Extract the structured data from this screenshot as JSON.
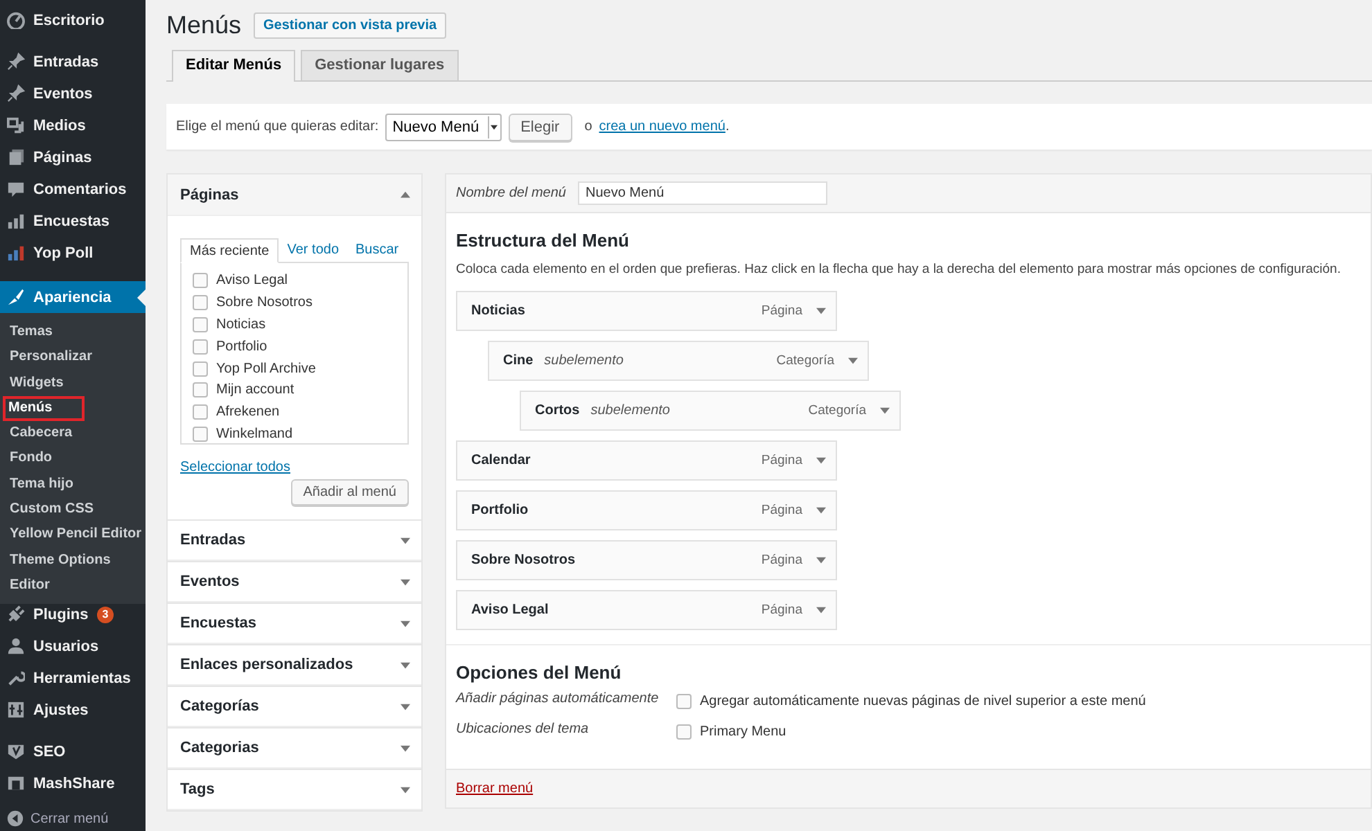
{
  "sidebar": {
    "sections": [
      [
        {
          "label": "Escritorio",
          "current": false
        }
      ],
      [
        {
          "label": "Entradas",
          "current": false
        },
        {
          "label": "Eventos",
          "current": false
        },
        {
          "label": "Medios",
          "current": false
        },
        {
          "label": "Páginas",
          "current": false
        },
        {
          "label": "Comentarios",
          "current": false
        },
        {
          "label": "Encuestas",
          "current": false
        },
        {
          "label": "Yop Poll",
          "current": false
        }
      ],
      [
        {
          "label": "Apariencia",
          "current": true,
          "submenu": [
            {
              "label": "Temas",
              "selected": false,
              "highlighted": false
            },
            {
              "label": "Personalizar",
              "selected": false,
              "highlighted": false
            },
            {
              "label": "Widgets",
              "selected": false,
              "highlighted": false
            },
            {
              "label": "Menús",
              "selected": true,
              "highlighted": true
            },
            {
              "label": "Cabecera",
              "selected": false,
              "highlighted": false
            },
            {
              "label": "Fondo",
              "selected": false,
              "highlighted": false
            },
            {
              "label": "Tema hijo",
              "selected": false,
              "highlighted": false
            },
            {
              "label": "Custom CSS",
              "selected": false,
              "highlighted": false
            },
            {
              "label": "Yellow Pencil Editor",
              "selected": false,
              "highlighted": false
            },
            {
              "label": "Theme Options",
              "selected": false,
              "highlighted": false
            },
            {
              "label": "Editor",
              "selected": false,
              "highlighted": false
            }
          ]
        },
        {
          "label": "Plugins",
          "current": false,
          "badge": "3"
        },
        {
          "label": "Usuarios",
          "current": false
        },
        {
          "label": "Herramientas",
          "current": false
        },
        {
          "label": "Ajustes",
          "current": false
        }
      ],
      [
        {
          "label": "SEO",
          "current": false
        },
        {
          "label": "MashShare",
          "current": false
        }
      ]
    ],
    "collapse_label": "Cerrar menú"
  },
  "page": {
    "title": "Menús",
    "preview_button": "Gestionar con vista previa"
  },
  "tabs": [
    {
      "label": "Editar Menús",
      "selected": true
    },
    {
      "label": "Gestionar lugares",
      "selected": false
    }
  ],
  "menu_select": {
    "label": "Elige el menú que quieras editar:",
    "value": "Nuevo Menú",
    "button": "Elegir",
    "or_text": "o",
    "create_link": "crea un nuevo menú",
    "end_text": "."
  },
  "add_items": {
    "sections": [
      {
        "title": "Páginas",
        "expanded": true
      },
      {
        "title": "Entradas",
        "expanded": false
      },
      {
        "title": "Eventos",
        "expanded": false
      },
      {
        "title": "Encuestas",
        "expanded": false
      },
      {
        "title": "Enlaces personalizados",
        "expanded": false
      },
      {
        "title": "Categorías",
        "expanded": false
      },
      {
        "title": "Categorias",
        "expanded": false
      },
      {
        "title": "Tags",
        "expanded": false
      }
    ],
    "pages": {
      "tabs": [
        {
          "label": "Más reciente",
          "selected": true
        },
        {
          "label": "Ver todo",
          "selected": false
        },
        {
          "label": "Buscar",
          "selected": false
        }
      ],
      "items": [
        {
          "label": "Aviso Legal",
          "checked": false
        },
        {
          "label": "Sobre Nosotros",
          "checked": false
        },
        {
          "label": "Noticias",
          "checked": false
        },
        {
          "label": "Portfolio",
          "checked": false
        },
        {
          "label": "Yop Poll Archive",
          "checked": false
        },
        {
          "label": "Mijn account",
          "checked": false
        },
        {
          "label": "Afrekenen",
          "checked": false
        },
        {
          "label": "Winkelmand",
          "checked": false
        }
      ],
      "select_all": "Seleccionar todos",
      "add_button": "Añadir al menú"
    }
  },
  "menu_editor": {
    "name_label": "Nombre del menú",
    "name_value": "Nuevo Menú",
    "structure_title": "Estructura del Menú",
    "structure_hint": "Coloca cada elemento en el orden que prefieras. Haz click en la flecha que hay a la derecha del elemento para mostrar más opciones de configuración.",
    "items": [
      {
        "title": "Noticias",
        "type": "Página",
        "children": [
          {
            "title": "Cine",
            "note": "subelemento",
            "type": "Categoría",
            "children": [
              {
                "title": "Cortos",
                "note": "subelemento",
                "type": "Categoría"
              }
            ]
          }
        ]
      },
      {
        "title": "Calendar",
        "type": "Página"
      },
      {
        "title": "Portfolio",
        "type": "Página"
      },
      {
        "title": "Sobre Nosotros",
        "type": "Página"
      },
      {
        "title": "Aviso Legal",
        "type": "Página"
      }
    ],
    "options_title": "Opciones del Menú",
    "options": [
      {
        "label": "Añadir páginas automáticamente",
        "choices": [
          {
            "label": "Agregar automáticamente nuevas páginas de nivel superior a este menú",
            "checked": false
          }
        ]
      },
      {
        "label": "Ubicaciones del tema",
        "choices": [
          {
            "label": "Primary Menu",
            "checked": false
          }
        ]
      }
    ],
    "delete_link": "Borrar menú"
  }
}
